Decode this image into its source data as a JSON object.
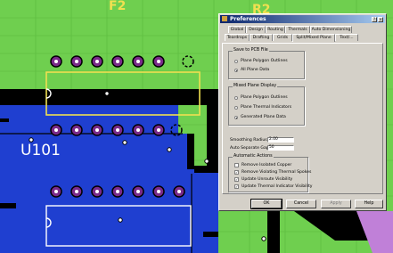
{
  "canvas": {
    "component_label": "U101",
    "top_fragments": [
      "F2",
      "R2"
    ]
  },
  "dialog": {
    "title": "Preferences",
    "title_buttons": [
      "?",
      "×"
    ],
    "tabs_back": [
      "Global",
      "Design",
      "Routing",
      "Thermals",
      "Auto Dimensioning"
    ],
    "tabs_front": [
      "Teardrops",
      "Drafting",
      "Grids",
      "Split/Mixed Plane",
      "Text/..."
    ],
    "active_tab": "Split/Mixed Plane",
    "groups": {
      "save_pcb": {
        "title": "Save to PCB File",
        "options": [
          {
            "label": "Plane Polygon Outlines",
            "checked": false
          },
          {
            "label": "All Plane Data",
            "checked": true
          }
        ]
      },
      "mixed_plane": {
        "title": "Mixed Plane Display",
        "options": [
          {
            "label": "Plane Polygon Outlines",
            "checked": false
          },
          {
            "label": "Plane Thermal Indicators",
            "checked": false
          },
          {
            "label": "Generated Plane Data",
            "checked": true
          }
        ]
      },
      "smoothing": {
        "radius_label": "Smoothing Radius:",
        "radius_value": "2.00",
        "auto_sep_label": "Auto Separate Gap:",
        "auto_sep_value": "50"
      },
      "auto_actions": {
        "title": "Automatic Actions",
        "options": [
          {
            "label": "Remove Isolated Copper",
            "checked": false
          },
          {
            "label": "Remove Violating Thermal Spokes",
            "checked": true
          },
          {
            "label": "Update Unroute Visibility",
            "checked": true
          },
          {
            "label": "Update Thermal Indicator Visibility",
            "checked": true
          }
        ]
      }
    },
    "buttons": {
      "ok": "OK",
      "cancel": "Cancel",
      "apply": "Apply",
      "help": "Help"
    }
  },
  "colors": {
    "board_green": "#6fcf4f",
    "plane_blue": "#1f3fd0",
    "trace_black": "#000000",
    "pad_purple": "#7a2a8a",
    "selection_yellow": "#f0e050",
    "outline_white": "#ffffff"
  }
}
